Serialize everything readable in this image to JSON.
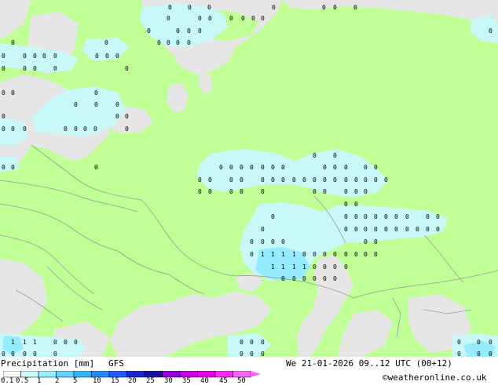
{
  "legend": {
    "title": "Precipitation [mm]",
    "model": "GFS",
    "levels": [
      "0.1",
      "0.5",
      "1",
      "2",
      "5",
      "10",
      "15",
      "20",
      "25",
      "30",
      "35",
      "40",
      "45",
      "50"
    ],
    "colors": [
      "#f5fff5",
      "#c8f8f8",
      "#96ecff",
      "#64d2ff",
      "#32b4ff",
      "#2389ff",
      "#1e5aff",
      "#1e28d2",
      "#1414a0",
      "#9600dc",
      "#c800e6",
      "#e600e6",
      "#ff28ff",
      "#ff64ff"
    ]
  },
  "valid_time": "We 21-01-2026 09..12 UTC (00+12)",
  "credit": "©weatheronline.co.uk",
  "colors": {
    "land": "#c0ff96",
    "sea": "#e6e6e6",
    "precip_light": "#c8f8f8",
    "precip_medium": "#96ecff",
    "border": "#999999"
  }
}
